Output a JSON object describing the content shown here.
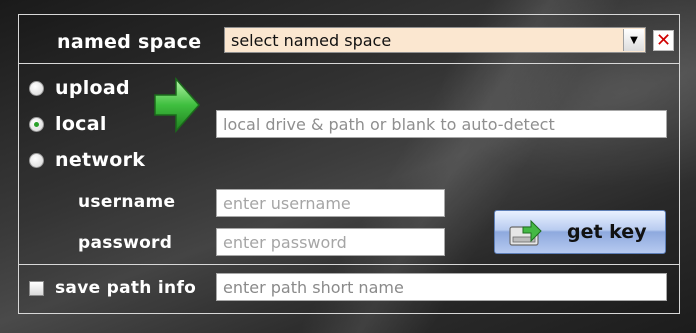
{
  "named_space": {
    "label": "named space",
    "select_value": "select named space"
  },
  "source": {
    "options": [
      {
        "label": "upload",
        "checked": false
      },
      {
        "label": "local",
        "checked": true
      },
      {
        "label": "network",
        "checked": false
      }
    ],
    "path_placeholder": "local drive & path or blank to auto-detect"
  },
  "credentials": {
    "username_label": "username",
    "username_placeholder": "enter username",
    "password_label": "password",
    "password_placeholder": "enter password"
  },
  "get_key": {
    "label": "get key"
  },
  "save_path": {
    "label": "save path info",
    "checked": false,
    "placeholder": "enter path short name"
  },
  "colors": {
    "select_bg": "#fbe7d0",
    "close_x": "#d00000",
    "arrow_green": "#3fbf3f",
    "button_blue": "#8ea9de"
  },
  "icons": {
    "arrow": "green-right-arrow-icon",
    "close": "close-icon",
    "dropdown": "chevron-down-icon",
    "get_key": "key-drive-icon"
  }
}
